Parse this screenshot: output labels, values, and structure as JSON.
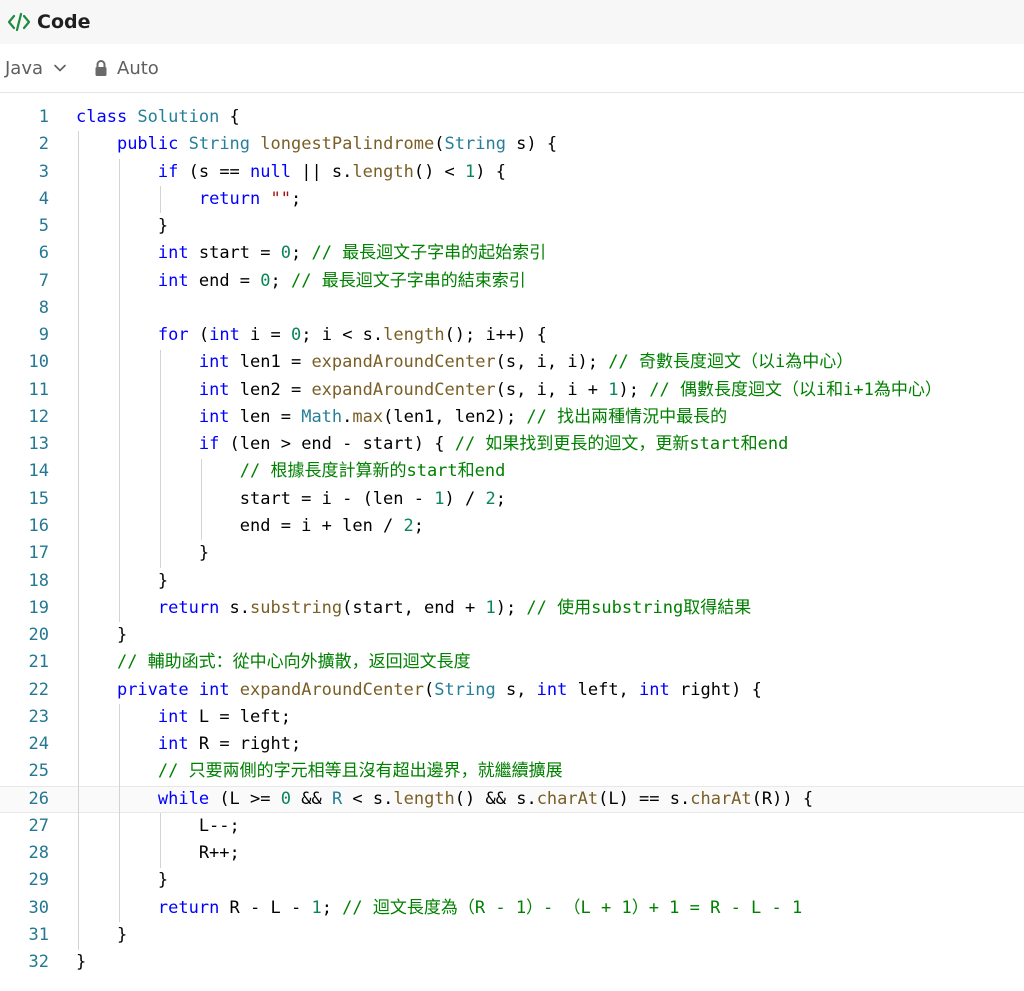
{
  "header": {
    "title": "Code",
    "icon": "code-icon"
  },
  "toolbar": {
    "language": "Java",
    "mode": "Auto"
  },
  "editor": {
    "current_line": 26,
    "lines": [
      [
        [
          "class ",
          "kw"
        ],
        [
          "Solution",
          "ty"
        ],
        [
          " {",
          ""
        ]
      ],
      [
        [
          "    ",
          ""
        ],
        [
          "public ",
          "kw"
        ],
        [
          "String ",
          "ty"
        ],
        [
          "longestPalindrome",
          "fn"
        ],
        [
          "(",
          ""
        ],
        [
          "String ",
          "ty"
        ],
        [
          "s",
          ""
        ],
        [
          ") {",
          ""
        ]
      ],
      [
        [
          "        ",
          ""
        ],
        [
          "if ",
          "kw"
        ],
        [
          "(s == ",
          ""
        ],
        [
          "null ",
          "kw"
        ],
        [
          "|| s.",
          ""
        ],
        [
          "length",
          "fn"
        ],
        [
          "() < ",
          ""
        ],
        [
          "1",
          "num"
        ],
        [
          ") {",
          ""
        ]
      ],
      [
        [
          "            ",
          ""
        ],
        [
          "return ",
          "kw"
        ],
        [
          "\"\"",
          "str"
        ],
        [
          ";",
          ""
        ]
      ],
      [
        [
          "        }",
          ""
        ]
      ],
      [
        [
          "        ",
          ""
        ],
        [
          "int ",
          "kw"
        ],
        [
          "start = ",
          ""
        ],
        [
          "0",
          "num"
        ],
        [
          "; ",
          ""
        ],
        [
          "// 最長迴文子字串的起始索引",
          "cmt"
        ]
      ],
      [
        [
          "        ",
          ""
        ],
        [
          "int ",
          "kw"
        ],
        [
          "end = ",
          ""
        ],
        [
          "0",
          "num"
        ],
        [
          "; ",
          ""
        ],
        [
          "// 最長迴文子字串的結束索引",
          "cmt"
        ]
      ],
      [
        [
          "",
          ""
        ]
      ],
      [
        [
          "        ",
          ""
        ],
        [
          "for ",
          "kw"
        ],
        [
          "(",
          ""
        ],
        [
          "int ",
          "kw"
        ],
        [
          "i = ",
          ""
        ],
        [
          "0",
          "num"
        ],
        [
          "; i < s.",
          ""
        ],
        [
          "length",
          "fn"
        ],
        [
          "(); i++) {",
          ""
        ]
      ],
      [
        [
          "            ",
          ""
        ],
        [
          "int ",
          "kw"
        ],
        [
          "len1 = ",
          ""
        ],
        [
          "expandAroundCenter",
          "fn"
        ],
        [
          "(s, i, i); ",
          ""
        ],
        [
          "// 奇數長度迴文（以i為中心）",
          "cmt"
        ]
      ],
      [
        [
          "            ",
          ""
        ],
        [
          "int ",
          "kw"
        ],
        [
          "len2 = ",
          ""
        ],
        [
          "expandAroundCenter",
          "fn"
        ],
        [
          "(s, i, i + ",
          ""
        ],
        [
          "1",
          "num"
        ],
        [
          "); ",
          ""
        ],
        [
          "// 偶數長度迴文（以i和i+1為中心）",
          "cmt"
        ]
      ],
      [
        [
          "            ",
          ""
        ],
        [
          "int ",
          "kw"
        ],
        [
          "len = ",
          ""
        ],
        [
          "Math",
          "ty"
        ],
        [
          ".",
          ""
        ],
        [
          "max",
          "fn"
        ],
        [
          "(len1, len2); ",
          ""
        ],
        [
          "// 找出兩種情況中最長的",
          "cmt"
        ]
      ],
      [
        [
          "            ",
          ""
        ],
        [
          "if ",
          "kw"
        ],
        [
          "(len > end - start) { ",
          ""
        ],
        [
          "// 如果找到更長的迴文，更新start和end",
          "cmt"
        ]
      ],
      [
        [
          "                ",
          ""
        ],
        [
          "// 根據長度計算新的start和end",
          "cmt"
        ]
      ],
      [
        [
          "                start = i - (len - ",
          ""
        ],
        [
          "1",
          "num"
        ],
        [
          ") / ",
          ""
        ],
        [
          "2",
          "num"
        ],
        [
          ";",
          ""
        ]
      ],
      [
        [
          "                end = i + len / ",
          ""
        ],
        [
          "2",
          "num"
        ],
        [
          ";",
          ""
        ]
      ],
      [
        [
          "            }",
          ""
        ]
      ],
      [
        [
          "        }",
          ""
        ]
      ],
      [
        [
          "        ",
          ""
        ],
        [
          "return ",
          "kw"
        ],
        [
          "s.",
          ""
        ],
        [
          "substring",
          "fn"
        ],
        [
          "(start, end + ",
          ""
        ],
        [
          "1",
          "num"
        ],
        [
          "); ",
          ""
        ],
        [
          "// 使用substring取得結果",
          "cmt"
        ]
      ],
      [
        [
          "    }",
          ""
        ]
      ],
      [
        [
          "    ",
          ""
        ],
        [
          "// 輔助函式：從中心向外擴散，返回迴文長度",
          "cmt"
        ]
      ],
      [
        [
          "    ",
          ""
        ],
        [
          "private ",
          "kw"
        ],
        [
          "int ",
          "kw"
        ],
        [
          "expandAroundCenter",
          "fn"
        ],
        [
          "(",
          ""
        ],
        [
          "String ",
          "ty"
        ],
        [
          "s, ",
          ""
        ],
        [
          "int ",
          "kw"
        ],
        [
          "left, ",
          ""
        ],
        [
          "int ",
          "kw"
        ],
        [
          "right) {",
          ""
        ]
      ],
      [
        [
          "        ",
          ""
        ],
        [
          "int ",
          "kw"
        ],
        [
          "L = left;",
          ""
        ]
      ],
      [
        [
          "        ",
          ""
        ],
        [
          "int ",
          "kw"
        ],
        [
          "R = right;",
          ""
        ]
      ],
      [
        [
          "        ",
          ""
        ],
        [
          "// 只要兩側的字元相等且沒有超出邊界，就繼續擴展",
          "cmt"
        ]
      ],
      [
        [
          "        ",
          ""
        ],
        [
          "while ",
          "kw"
        ],
        [
          "(L >= ",
          ""
        ],
        [
          "0 ",
          "num"
        ],
        [
          "&& ",
          ""
        ],
        [
          "R ",
          "ty"
        ],
        [
          "< s.",
          ""
        ],
        [
          "length",
          "fn"
        ],
        [
          "() && s.",
          ""
        ],
        [
          "charAt",
          "fn"
        ],
        [
          "(L) == s.",
          ""
        ],
        [
          "charAt",
          "fn"
        ],
        [
          "(R)) {",
          ""
        ]
      ],
      [
        [
          "            L--;",
          ""
        ]
      ],
      [
        [
          "            R++;",
          ""
        ]
      ],
      [
        [
          "        }",
          ""
        ]
      ],
      [
        [
          "        ",
          ""
        ],
        [
          "return ",
          "kw"
        ],
        [
          "R - L - ",
          ""
        ],
        [
          "1",
          "num"
        ],
        [
          "; ",
          ""
        ],
        [
          "// 迴文長度為（R - 1）- （L + 1）+ 1 = R - L - 1",
          "cmt"
        ]
      ],
      [
        [
          "    }",
          ""
        ]
      ],
      [
        [
          "}",
          ""
        ]
      ]
    ]
  }
}
